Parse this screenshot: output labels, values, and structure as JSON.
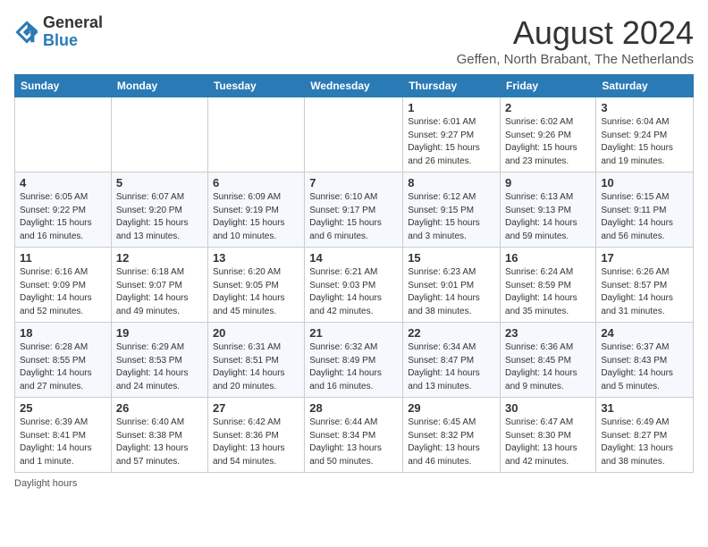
{
  "header": {
    "logo_line1": "General",
    "logo_line2": "Blue",
    "month_title": "August 2024",
    "subtitle": "Geffen, North Brabant, The Netherlands"
  },
  "days_of_week": [
    "Sunday",
    "Monday",
    "Tuesday",
    "Wednesday",
    "Thursday",
    "Friday",
    "Saturday"
  ],
  "footer_text": "Daylight hours",
  "weeks": [
    [
      {
        "day": "",
        "info": ""
      },
      {
        "day": "",
        "info": ""
      },
      {
        "day": "",
        "info": ""
      },
      {
        "day": "",
        "info": ""
      },
      {
        "day": "1",
        "info": "Sunrise: 6:01 AM\nSunset: 9:27 PM\nDaylight: 15 hours\nand 26 minutes."
      },
      {
        "day": "2",
        "info": "Sunrise: 6:02 AM\nSunset: 9:26 PM\nDaylight: 15 hours\nand 23 minutes."
      },
      {
        "day": "3",
        "info": "Sunrise: 6:04 AM\nSunset: 9:24 PM\nDaylight: 15 hours\nand 19 minutes."
      }
    ],
    [
      {
        "day": "4",
        "info": "Sunrise: 6:05 AM\nSunset: 9:22 PM\nDaylight: 15 hours\nand 16 minutes."
      },
      {
        "day": "5",
        "info": "Sunrise: 6:07 AM\nSunset: 9:20 PM\nDaylight: 15 hours\nand 13 minutes."
      },
      {
        "day": "6",
        "info": "Sunrise: 6:09 AM\nSunset: 9:19 PM\nDaylight: 15 hours\nand 10 minutes."
      },
      {
        "day": "7",
        "info": "Sunrise: 6:10 AM\nSunset: 9:17 PM\nDaylight: 15 hours\nand 6 minutes."
      },
      {
        "day": "8",
        "info": "Sunrise: 6:12 AM\nSunset: 9:15 PM\nDaylight: 15 hours\nand 3 minutes."
      },
      {
        "day": "9",
        "info": "Sunrise: 6:13 AM\nSunset: 9:13 PM\nDaylight: 14 hours\nand 59 minutes."
      },
      {
        "day": "10",
        "info": "Sunrise: 6:15 AM\nSunset: 9:11 PM\nDaylight: 14 hours\nand 56 minutes."
      }
    ],
    [
      {
        "day": "11",
        "info": "Sunrise: 6:16 AM\nSunset: 9:09 PM\nDaylight: 14 hours\nand 52 minutes."
      },
      {
        "day": "12",
        "info": "Sunrise: 6:18 AM\nSunset: 9:07 PM\nDaylight: 14 hours\nand 49 minutes."
      },
      {
        "day": "13",
        "info": "Sunrise: 6:20 AM\nSunset: 9:05 PM\nDaylight: 14 hours\nand 45 minutes."
      },
      {
        "day": "14",
        "info": "Sunrise: 6:21 AM\nSunset: 9:03 PM\nDaylight: 14 hours\nand 42 minutes."
      },
      {
        "day": "15",
        "info": "Sunrise: 6:23 AM\nSunset: 9:01 PM\nDaylight: 14 hours\nand 38 minutes."
      },
      {
        "day": "16",
        "info": "Sunrise: 6:24 AM\nSunset: 8:59 PM\nDaylight: 14 hours\nand 35 minutes."
      },
      {
        "day": "17",
        "info": "Sunrise: 6:26 AM\nSunset: 8:57 PM\nDaylight: 14 hours\nand 31 minutes."
      }
    ],
    [
      {
        "day": "18",
        "info": "Sunrise: 6:28 AM\nSunset: 8:55 PM\nDaylight: 14 hours\nand 27 minutes."
      },
      {
        "day": "19",
        "info": "Sunrise: 6:29 AM\nSunset: 8:53 PM\nDaylight: 14 hours\nand 24 minutes."
      },
      {
        "day": "20",
        "info": "Sunrise: 6:31 AM\nSunset: 8:51 PM\nDaylight: 14 hours\nand 20 minutes."
      },
      {
        "day": "21",
        "info": "Sunrise: 6:32 AM\nSunset: 8:49 PM\nDaylight: 14 hours\nand 16 minutes."
      },
      {
        "day": "22",
        "info": "Sunrise: 6:34 AM\nSunset: 8:47 PM\nDaylight: 14 hours\nand 13 minutes."
      },
      {
        "day": "23",
        "info": "Sunrise: 6:36 AM\nSunset: 8:45 PM\nDaylight: 14 hours\nand 9 minutes."
      },
      {
        "day": "24",
        "info": "Sunrise: 6:37 AM\nSunset: 8:43 PM\nDaylight: 14 hours\nand 5 minutes."
      }
    ],
    [
      {
        "day": "25",
        "info": "Sunrise: 6:39 AM\nSunset: 8:41 PM\nDaylight: 14 hours\nand 1 minute."
      },
      {
        "day": "26",
        "info": "Sunrise: 6:40 AM\nSunset: 8:38 PM\nDaylight: 13 hours\nand 57 minutes."
      },
      {
        "day": "27",
        "info": "Sunrise: 6:42 AM\nSunset: 8:36 PM\nDaylight: 13 hours\nand 54 minutes."
      },
      {
        "day": "28",
        "info": "Sunrise: 6:44 AM\nSunset: 8:34 PM\nDaylight: 13 hours\nand 50 minutes."
      },
      {
        "day": "29",
        "info": "Sunrise: 6:45 AM\nSunset: 8:32 PM\nDaylight: 13 hours\nand 46 minutes."
      },
      {
        "day": "30",
        "info": "Sunrise: 6:47 AM\nSunset: 8:30 PM\nDaylight: 13 hours\nand 42 minutes."
      },
      {
        "day": "31",
        "info": "Sunrise: 6:49 AM\nSunset: 8:27 PM\nDaylight: 13 hours\nand 38 minutes."
      }
    ]
  ]
}
